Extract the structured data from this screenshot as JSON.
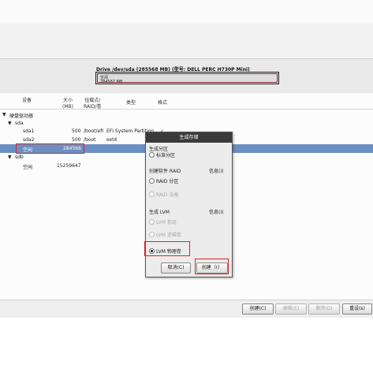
{
  "drive": {
    "title": "Drive /dev/sda (285568 MB) (型号: DELL PERC H730P Mini)",
    "bar_label": "空闲",
    "bar_size": "284567 MB"
  },
  "table": {
    "headers": {
      "device": "设备",
      "size_l1": "大小",
      "size_l2": "(MB)",
      "mount_l1": "挂载点/",
      "mount_l2": "RAID/卷",
      "type": "类型",
      "format": "格式"
    },
    "root_label": "硬盘驱动器",
    "rows": [
      {
        "device": "sda",
        "size": "",
        "mount": "",
        "type": ""
      },
      {
        "device": "sda1",
        "size": "500",
        "mount": "/boot/efi",
        "type": "EFI System Partition",
        "format": "✓"
      },
      {
        "device": "sda2",
        "size": "500",
        "mount": "/boot",
        "type": "ext4",
        "format": ""
      },
      {
        "device": "空闲",
        "size": "284566",
        "mount": "",
        "type": ""
      },
      {
        "device": "sdb",
        "size": "",
        "mount": "",
        "type": ""
      },
      {
        "device": "空闲",
        "size": "15259647",
        "mount": "",
        "type": ""
      }
    ]
  },
  "buttons": {
    "create": "创建(C)",
    "edit": "编辑(E)",
    "delete": "删除(D)",
    "reset": "重设(s)"
  },
  "dialog": {
    "title": "生成存储",
    "section_partition": "生成分区",
    "standard_partition": "标准分区",
    "section_raid": "创建软件 RAID",
    "info_raid": "信息(I)",
    "raid_partition": "RAID 分区",
    "raid_device": "RAID 设备",
    "section_lvm": "生成 LVM",
    "info_lvm": "信息(I)",
    "lvm_vg": "LVM 卷组",
    "lvm_lv": "LVM 逻辑卷",
    "lvm_pv": "LVM 物理卷",
    "cancel": "取消(C)",
    "create": "创建（r）"
  },
  "colors": {
    "selection": "#6b8fc1",
    "highlight_box": "#d8242c",
    "dialog_title_bg": "#3a3a3a"
  }
}
